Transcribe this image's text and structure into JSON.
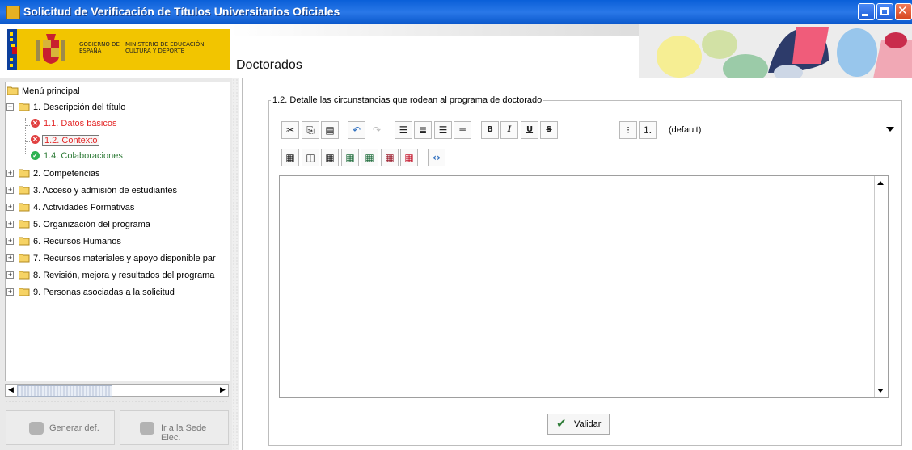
{
  "window": {
    "title": "Solicitud de Verificación de Títulos Universitarios Oficiales"
  },
  "header": {
    "logo_text_1": "GOBIERNO DE ESPAÑA",
    "logo_text_2": "MINISTERIO DE EDUCACIÓN, CULTURA Y DEPORTE",
    "page_title": "Doctorados"
  },
  "tree": {
    "root": "Menú principal",
    "items": [
      {
        "label": "1. Descripción del título",
        "expanded": true,
        "children": [
          {
            "label": "1.1. Datos básicos",
            "status": "error"
          },
          {
            "label": "1.2. Contexto",
            "status": "error",
            "selected": true
          },
          {
            "label": "1.4. Colaboraciones",
            "status": "ok"
          }
        ]
      },
      {
        "label": "2. Competencias"
      },
      {
        "label": "3. Acceso y admisión de estudiantes"
      },
      {
        "label": "4. Actividades Formativas"
      },
      {
        "label": "5. Organización del programa"
      },
      {
        "label": "6. Recursos Humanos"
      },
      {
        "label": "7. Recursos materiales y apoyo disponible par"
      },
      {
        "label": "8. Revisión, mejora y resultados del programa"
      },
      {
        "label": "9. Personas asociadas a la solicitud"
      }
    ]
  },
  "buttons": {
    "generar": "Generar def.",
    "sede": "Ir a la Sede Elec."
  },
  "section": {
    "legend": "1.2. Detalle las circunstancias que rodean al programa de doctorado"
  },
  "toolbar": {
    "font_select": "(default)",
    "bold": "B",
    "italic": "I",
    "underline": "U",
    "strike": "S"
  },
  "editor": {
    "content": ""
  },
  "validar": {
    "label": "Validar"
  },
  "colors": {
    "titlebar": "#0a5fd8",
    "logo_yellow": "#f2c500",
    "error": "#e14141",
    "ok": "#2db250"
  }
}
